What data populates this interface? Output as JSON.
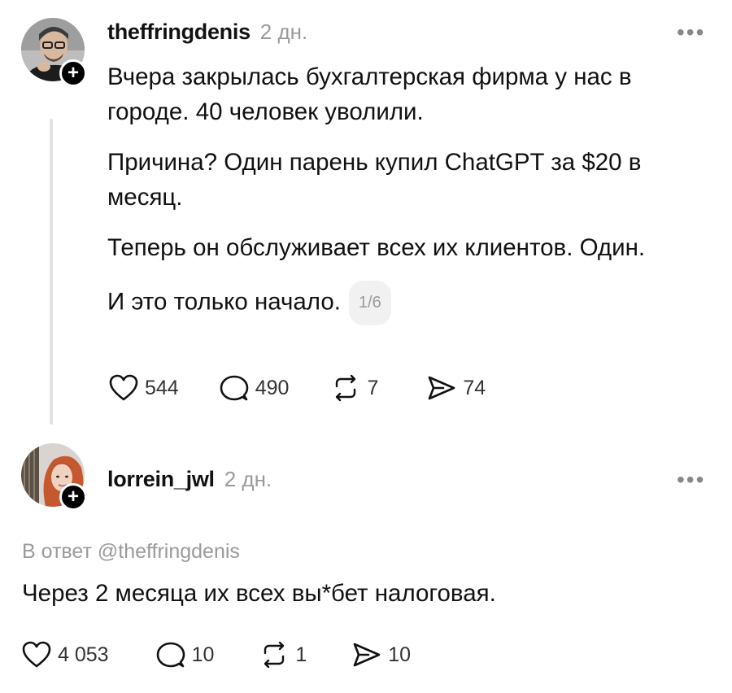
{
  "post": {
    "username": "theffringdenis",
    "time": "2 дн.",
    "paragraphs": [
      "Вчера закрылась бухгалтерская фирма у нас в городе. 40 человек уволили.",
      "Причина? Один парень купил ChatGPT за $20 в месяц.",
      "Теперь он обслуживает всех их клиентов. Один.",
      "И это только начало."
    ],
    "counter": "1/6",
    "likes": "544",
    "comments": "490",
    "reposts": "7",
    "shares": "74"
  },
  "reply": {
    "username": "lorrein_jwl",
    "time": "2 дн.",
    "reply_to": "В ответ @theffringdenis",
    "text": "Через 2 месяца их всех вы*бет налоговая.",
    "likes": "4 053",
    "comments": "10",
    "reposts": "1",
    "shares": "10"
  },
  "ui": {
    "more": "•••",
    "follow": "+",
    "icons": [
      "heart-icon",
      "comment-icon",
      "repost-icon",
      "share-icon",
      "more-icon"
    ]
  }
}
